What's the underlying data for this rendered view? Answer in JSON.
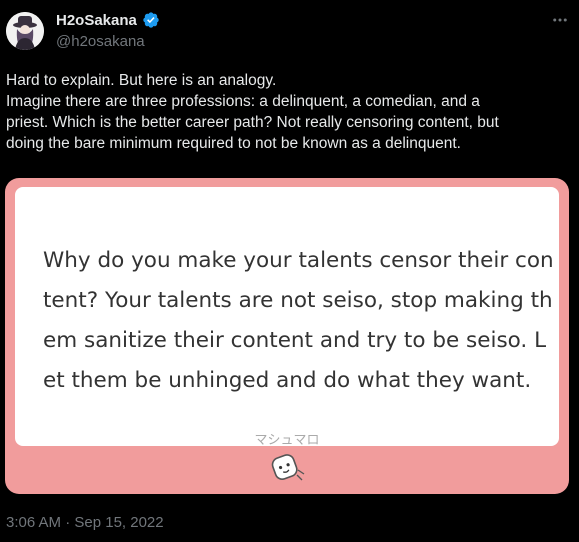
{
  "author": {
    "display_name": "H2oSakana",
    "handle": "@h2osakana",
    "verified": true,
    "avatar_icon": "avatar-icon",
    "verified_icon": "verified-badge-icon"
  },
  "tweet": {
    "text_lines": [
      "Hard to explain. But here is an analogy.",
      "Imagine there are three professions: a delinquent, a comedian, and a",
      "priest. Which is the better career path? Not really censoring content, but",
      "doing the bare minimum required to not be known as a delinquent."
    ],
    "timestamp": "3:06 AM · Sep 15, 2022"
  },
  "card": {
    "question_lines": [
      "Why do you make your talents censor their con",
      "tent? Your talents are not seiso, stop making th",
      "em sanitize their content and try to be seiso. L",
      "et them be unhinged and do what they want."
    ],
    "brand": "マシュマロ",
    "mascot_icon": "marshmallow-mascot-icon",
    "accent_color": "#f19c9c"
  },
  "more_icon": "more-options-icon",
  "colors": {
    "background": "#000000",
    "primary_text": "#e7e9ea",
    "secondary_text": "#71767b",
    "verified": "#1d9bf0"
  }
}
